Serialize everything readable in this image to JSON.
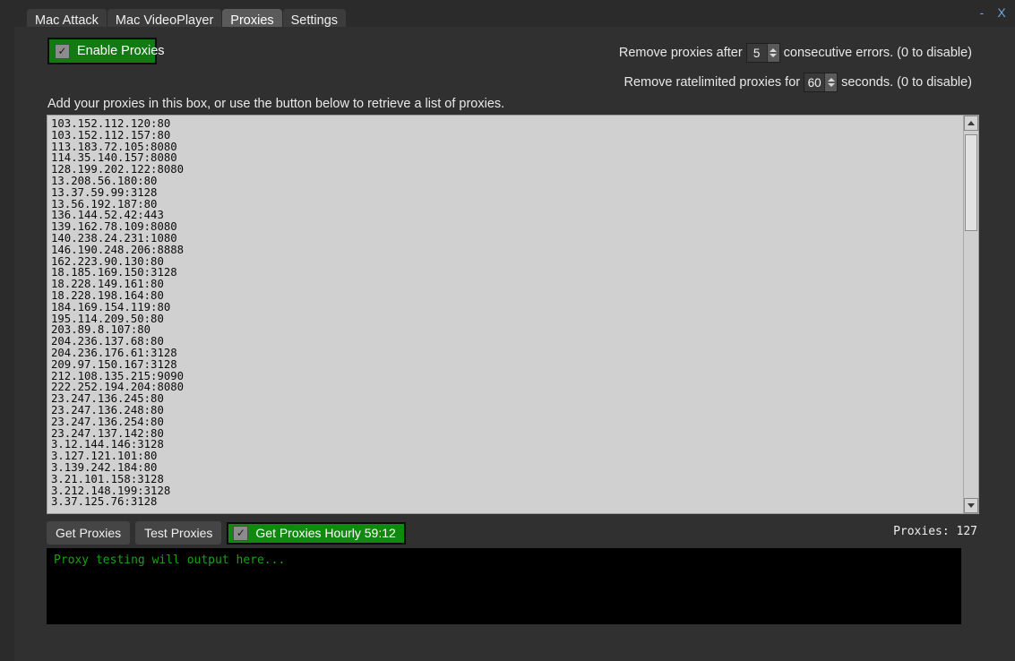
{
  "window": {
    "minimize_label": "-",
    "close_label": "X"
  },
  "tabs": [
    {
      "label": "Mac Attack",
      "active": false
    },
    {
      "label": "Mac VideoPlayer",
      "active": false
    },
    {
      "label": "Proxies",
      "active": true
    },
    {
      "label": "Settings",
      "active": false
    }
  ],
  "toolbar": {
    "enable_proxies_label": "Enable Proxies",
    "enable_proxies_checked": true,
    "checkmark": "✓"
  },
  "settings": {
    "errors_prefix": "Remove proxies after",
    "errors_value": "5",
    "errors_suffix": "consecutive errors. (0 to disable)",
    "ratelimit_prefix": "Remove ratelimited proxies for",
    "ratelimit_value": "60",
    "ratelimit_suffix": "seconds. (0 to disable)"
  },
  "hint": "Add your proxies in this box, or use the button below to retrieve a list of proxies.",
  "proxy_list": [
    "103.152.112.120:80",
    "103.152.112.157:80",
    "113.183.72.105:8080",
    "114.35.140.157:8080",
    "128.199.202.122:8080",
    "13.208.56.180:80",
    "13.37.59.99:3128",
    "13.56.192.187:80",
    "136.144.52.42:443",
    "139.162.78.109:8080",
    "140.238.24.231:1080",
    "146.190.248.206:8888",
    "162.223.90.130:80",
    "18.185.169.150:3128",
    "18.228.149.161:80",
    "18.228.198.164:80",
    "184.169.154.119:80",
    "195.114.209.50:80",
    "203.89.8.107:80",
    "204.236.137.68:80",
    "204.236.176.61:3128",
    "209.97.150.167:3128",
    "212.108.135.215:9090",
    "222.252.194.204:8080",
    "23.247.136.245:80",
    "23.247.136.248:80",
    "23.247.136.254:80",
    "23.247.137.142:80",
    "3.12.144.146:3128",
    "3.127.121.101:80",
    "3.139.242.184:80",
    "3.21.101.158:3128",
    "3.212.148.199:3128",
    "3.37.125.76:3128"
  ],
  "buttons": {
    "get_proxies": "Get Proxies",
    "test_proxies": "Test Proxies",
    "hourly_label": "Get Proxies Hourly 59:12",
    "hourly_checked": true
  },
  "status": {
    "proxy_count": "Proxies: 127"
  },
  "terminal": {
    "lines": "Proxy testing will output here..."
  },
  "colors": {
    "accent_green": "#127a12",
    "terminal_green": "#19a019",
    "window_bg": "#2b2b2b",
    "panel_bg": "#303030",
    "listbox_bg": "#d0d0d0"
  }
}
